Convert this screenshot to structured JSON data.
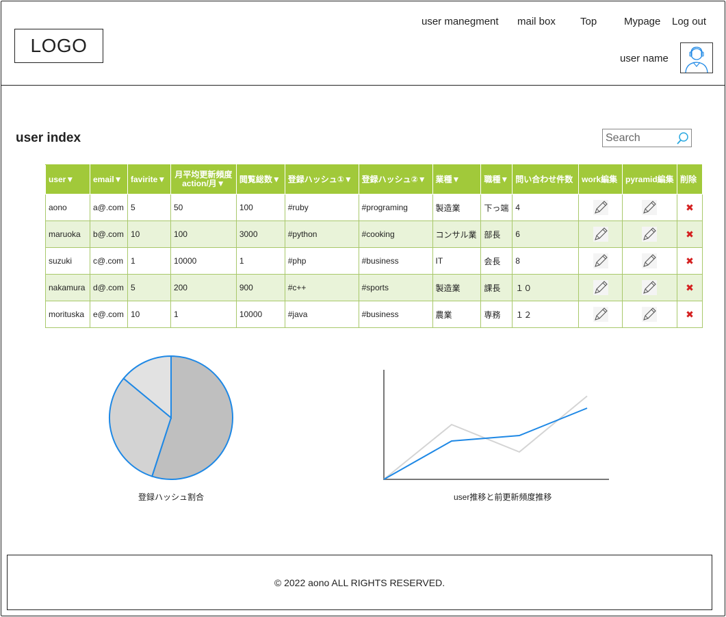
{
  "header": {
    "logo": "LOGO",
    "nav": [
      {
        "label": "user manegment",
        "name": "nav-user-management"
      },
      {
        "label": "mail box",
        "name": "nav-mail-box"
      },
      {
        "label": "Top",
        "name": "nav-top"
      },
      {
        "label": "Mypage",
        "name": "nav-mypage"
      },
      {
        "label": "Log out",
        "name": "nav-logout"
      }
    ],
    "user_name": "user name",
    "avatar_icon": "user-avatar-icon"
  },
  "main": {
    "title": "user index",
    "search": {
      "placeholder": "Search",
      "icon": "search-icon"
    }
  },
  "table": {
    "columns": [
      "user▼",
      "email▼",
      "favirite▼",
      "月平均更新頻度 action/月▼",
      "閲覧総数▼",
      "登録ハッシュ①▼",
      "登録ハッシュ②▼",
      "業種▼",
      "職種▼",
      "問い合わせ件数",
      "work編集",
      "pyramid編集",
      "削除"
    ],
    "rows": [
      [
        "aono",
        "a@.com",
        "5",
        "50",
        "100",
        "#ruby",
        "#programing",
        "製造業",
        "下っ端",
        "4"
      ],
      [
        "maruoka",
        "b@.com",
        "10",
        "100",
        "3000",
        "#python",
        "#cooking",
        "コンサル業",
        "部長",
        "6"
      ],
      [
        "suzuki",
        "c@.com",
        "1",
        "10000",
        "1",
        "#php",
        "#business",
        "IT",
        "会長",
        "8"
      ],
      [
        "nakamura",
        "d@.com",
        "5",
        "200",
        "900",
        "#c++",
        "#sports",
        "製造業",
        "課長",
        "１０"
      ],
      [
        "morituska",
        "e@.com",
        "10",
        "1",
        "10000",
        "#java",
        "#business",
        "農業",
        "専務",
        "１２"
      ]
    ],
    "edit_icon": "pencil-icon",
    "delete_glyph": "✖"
  },
  "pie_chart": {
    "label": "登録ハッシュ割合"
  },
  "line_chart": {
    "label": "user推移と前更新頻度推移"
  },
  "chart_data": [
    {
      "type": "pie",
      "title": "登録ハッシュ割合",
      "values": [
        0.55,
        0.31,
        0.14
      ],
      "colors": [
        "#bfbfbf",
        "#d3d3d3",
        "#e2e2e2"
      ],
      "stroke": "#1e88e5"
    },
    {
      "type": "line",
      "title": "user推移と前更新頻度推移",
      "xlabel": "",
      "ylabel": "",
      "x": [
        0,
        1,
        2,
        3
      ],
      "xlim": [
        0,
        3
      ],
      "ylim": [
        0,
        1
      ],
      "series": [
        {
          "values": [
            0,
            0.5,
            0.25,
            0.76
          ],
          "color": "#d4d4d4"
        },
        {
          "values": [
            0,
            0.35,
            0.4,
            0.65
          ],
          "color": "#1e88e5"
        }
      ],
      "grid": false
    }
  ],
  "footer": {
    "copyright": "© 2022 aono ALL RIGHTS RESERVED."
  }
}
